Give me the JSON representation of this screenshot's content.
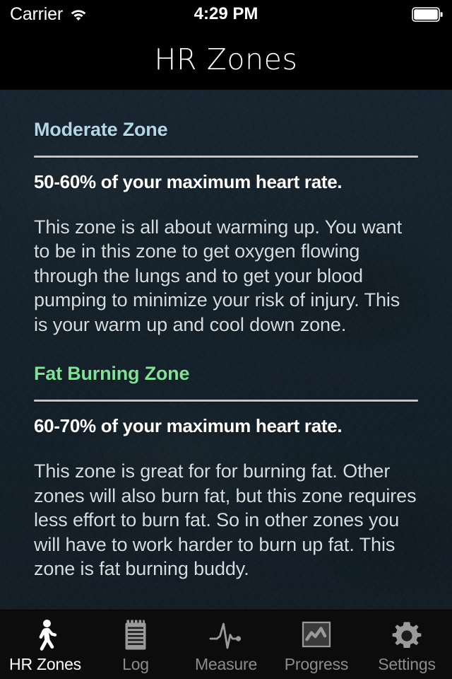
{
  "status_bar": {
    "carrier": "Carrier",
    "wifi_icon": "wifi-icon",
    "time": "4:29 PM",
    "battery_icon": "battery-full-icon"
  },
  "nav_bar": {
    "title": "HR Zones"
  },
  "colors": {
    "background": "#16222b",
    "moderate_zone_accent": "#b2d8e6",
    "fat_burning_zone_accent": "#7fe396",
    "body_text": "#d6dbde",
    "rule": "#c9c9c9",
    "tab_bar_background": "#0c0c0c",
    "tab_active": "#ffffff",
    "tab_inactive": "#8c8c8c"
  },
  "sections": [
    {
      "title": "Moderate Zone",
      "title_color": "#b2d8e6",
      "subtitle": "50-60% of your maximum heart rate.",
      "body": "This zone is all about warming up. You want to be in this zone to get oxygen flowing through the lungs and to get your blood pumping to minimize your risk of injury. This is your warm up and cool down zone."
    },
    {
      "title": "Fat Burning Zone",
      "title_color": "#7fe396",
      "subtitle": "60-70% of your maximum heart rate.",
      "body": "This zone is great for for burning fat. Other zones will also burn fat, but this zone requires less effort to burn fat. So in other zones you will have to work harder to burn up fat. This zone is fat burning buddy."
    }
  ],
  "tab_bar": {
    "items": [
      {
        "label": "HR Zones",
        "icon": "walking-person-icon",
        "active": true
      },
      {
        "label": "Log",
        "icon": "notepad-icon",
        "active": false
      },
      {
        "label": "Measure",
        "icon": "heartbeat-pulse-icon",
        "active": false
      },
      {
        "label": "Progress",
        "icon": "line-chart-box-icon",
        "active": false
      },
      {
        "label": "Settings",
        "icon": "gear-icon",
        "active": false
      }
    ]
  }
}
